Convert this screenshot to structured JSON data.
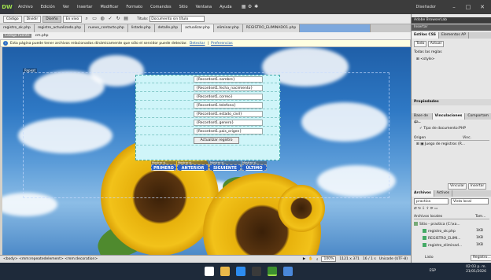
{
  "app": {
    "logo": "DW",
    "menu": [
      "Archivo",
      "Edición",
      "Ver",
      "Insertar",
      "Modificar",
      "Formato",
      "Comandos",
      "Sitio",
      "Ventana",
      "Ayuda"
    ],
    "workspace": "Diseñador",
    "window_buttons": [
      "–",
      "□",
      "✕"
    ]
  },
  "doc_toolbar": {
    "views": [
      "Código",
      "Dividir",
      "Diseño",
      "En vivo"
    ],
    "active_view": "Diseño",
    "title_label": "Título:",
    "title_value": "Documento sin título"
  },
  "tabs": [
    {
      "label": "registro_ok.php",
      "state": "normal"
    },
    {
      "label": "registro_actualizado.php",
      "state": "normal"
    },
    {
      "label": "nuevo_contacto.php",
      "state": "normal"
    },
    {
      "label": "listado.php",
      "state": "normal"
    },
    {
      "label": "detalle.php",
      "state": "normal"
    },
    {
      "label": "actualizar.php",
      "state": "active"
    },
    {
      "label": "eliminar.php",
      "state": "normal"
    },
    {
      "label": "REGISTRO_ELIMINADO1.php",
      "state": "normal"
    },
    {
      "label": "",
      "state": "blue"
    }
  ],
  "related_files": [
    "Código fuente",
    "cm.php"
  ],
  "infobar": {
    "text": "Esta página puede tener archivos relacionados dinámicamente que sólo el servidor puede detectar.",
    "links": [
      "Detectar",
      "Preferencias"
    ]
  },
  "canvas": {
    "guide_label": "Repeat",
    "form_fields": [
      "{Recordset1.nombre}",
      "{Recordset1.fecha_nacimiento}",
      "{Recordset1.correo}",
      "{Recordset1.telefono}",
      "{Recordset1.estado_civil}",
      "{Recordset1.genero}",
      "{Recordset1.pais_origen}"
    ],
    "submit_label": "Actualizar registro",
    "nav_tag": "Mostrar si...",
    "nav_links": [
      "PRIMERO",
      "ANTERIOR",
      "SIGUIENTE",
      "ÚLTIMO"
    ]
  },
  "statusbar": {
    "breadcrumb": "<body>   <mm:repeatedelement>  <mm:decoration>",
    "zoom": "100%",
    "size": "1121 x 371",
    "weight": "16 / 1 s",
    "encoding": "Unicode (UTF-8)"
  },
  "right_panel": {
    "browserlab_title": "Adobe BrowserLab",
    "insert_title": "Insertar",
    "css_tabs": [
      "Estilos CSS",
      "Elementos AP"
    ],
    "css_subtabs": [
      "Todo",
      "Actual"
    ],
    "rules_heading": "Todas las reglas",
    "rule_item": "<style>",
    "props_heading": "Propiedades",
    "bindings_tabs": [
      "Base de da",
      "Vinculaciones",
      "Comportam"
    ],
    "doc_type": "Tipo de documento:PHP",
    "binding_col1": "Origen",
    "binding_col2": "Vinc.",
    "binding_item": "Juego de registros (R...",
    "bind_button": "Vincular",
    "insert_button": "Insertar",
    "files_tabs": [
      "Archivos",
      "Activos"
    ],
    "site_select": "practica",
    "view_select": "Vista local",
    "files_col1": "Archivos locales",
    "files_col2": "Tam...",
    "site_root": "Sitio - practica (C:\\xa...",
    "files": [
      "registro_ok.php",
      "REGISTRO_ELIMI...",
      "registro_eliminad..."
    ],
    "file_sizes": [
      "1KB",
      "1KB",
      "1KB"
    ],
    "log_button": "Registro...",
    "ready": "Listo"
  },
  "taskbar": {
    "lang": "ESP",
    "time": "02:03 p. m.",
    "date": "21/01/2026",
    "icon_colors": [
      "#ffffff",
      "#e9b84a",
      "#2d8cf0",
      "#3a3a3a",
      "#3c8f2f",
      "#4a88da"
    ]
  }
}
